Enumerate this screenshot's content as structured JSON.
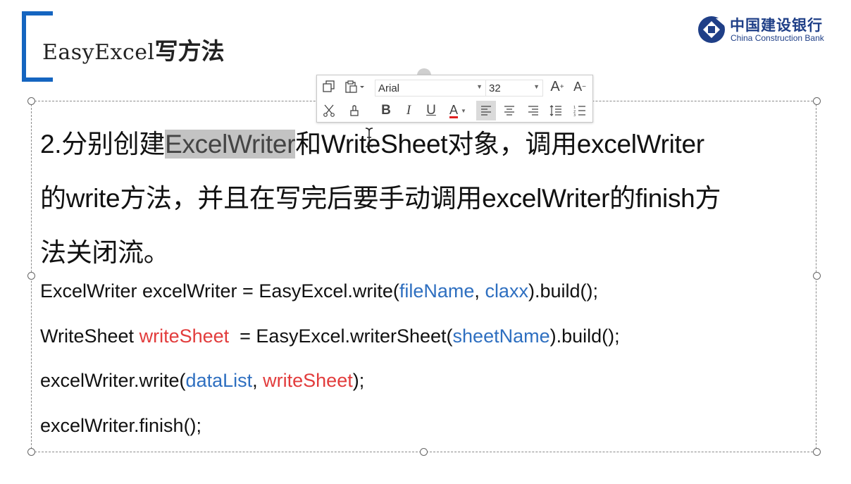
{
  "slide": {
    "title_latin": "EasyExcel",
    "title_cn": "写方法",
    "logo": {
      "cn": "中国建设银行",
      "en": "China Construction Bank",
      "icon": "ccb-logo-icon",
      "color": "#1f3f87"
    },
    "paragraph": {
      "line1_before": "2.分别创建",
      "line1_selected": "ExcelWriter",
      "line1_after": "和WriteSheet对象，调用excelWriter",
      "line2": "的write方法，并且在写完后要手动调用excelWriter的finish方",
      "line3": "法关闭流。"
    },
    "code": {
      "l1_a": "ExcelWriter excelWriter = EasyExcel.write(",
      "l1_p1": "fileName",
      "l1_b": ", ",
      "l1_p2": "claxx",
      "l1_c": ").build();",
      "l2_a": "WriteSheet ",
      "l2_var": "writeSheet",
      "l2_b": "  = EasyExcel.writerSheet(",
      "l2_p1": "sheetName",
      "l2_c": ").build();",
      "l3_a": "excelWriter.write(",
      "l3_p1": "dataList",
      "l3_b": ", ",
      "l3_p2": "writeSheet",
      "l3_c": ");",
      "l4": "excelWriter.finish();"
    },
    "colors": {
      "accent_bracket": "#1565c0",
      "param_blue": "#2e6fc0",
      "var_red": "#e23c3c",
      "selection": "#c3c3c3"
    }
  },
  "toolbar": {
    "font_name": "Arial",
    "font_size": "32",
    "buttons_row1": [
      "copy-icon",
      "paste-icon",
      "font-select",
      "font-size-select",
      "increase-font-icon",
      "decrease-font-icon"
    ],
    "buttons_row2": [
      "cut-icon",
      "format-painter-icon",
      "bold-icon",
      "italic-icon",
      "underline-icon",
      "font-color-icon",
      "align-left-icon",
      "align-center-icon",
      "align-right-icon",
      "line-spacing-icon",
      "numbering-icon"
    ],
    "active_button": "align-left-icon",
    "bold_label": "B",
    "italic_label": "I",
    "underline_label": "U",
    "font_color_label": "A",
    "grow_label": "A",
    "shrink_label": "A"
  }
}
